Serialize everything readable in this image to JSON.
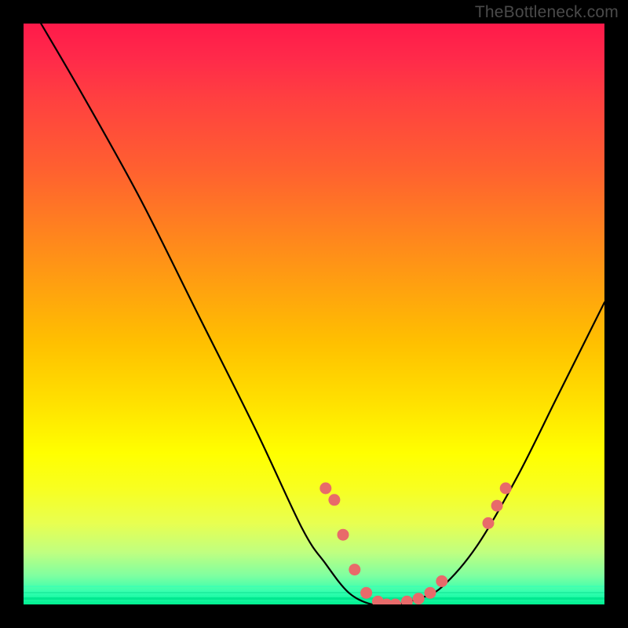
{
  "watermark": "TheBottleneck.com",
  "chart_data": {
    "type": "line",
    "title": "",
    "xlabel": "",
    "ylabel": "",
    "xlim": [
      0,
      100
    ],
    "ylim": [
      0,
      100
    ],
    "series": [
      {
        "name": "bottleneck-curve",
        "x": [
          3,
          10,
          20,
          30,
          40,
          48,
          52,
          56,
          60,
          64,
          68,
          72,
          78,
          85,
          92,
          100
        ],
        "values": [
          100,
          88,
          70,
          50,
          30,
          13,
          7,
          2,
          0,
          0,
          1,
          3,
          10,
          22,
          36,
          52
        ]
      }
    ],
    "highlight_points": {
      "name": "marker-dots",
      "x": [
        52,
        53.5,
        55,
        57,
        59,
        61,
        62.5,
        64,
        66,
        68,
        70,
        72,
        80,
        81.5,
        83
      ],
      "values": [
        20,
        18,
        12,
        6,
        2,
        0.5,
        0,
        0,
        0.5,
        1,
        2,
        4,
        14,
        17,
        20
      ]
    },
    "background_gradient": {
      "top_color": "#ff1a4a",
      "mid_color": "#ffe000",
      "bottom_color": "#00f090"
    }
  }
}
